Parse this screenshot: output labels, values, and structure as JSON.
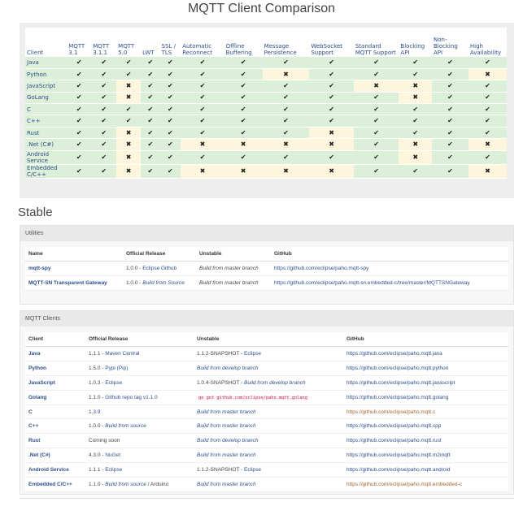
{
  "title": "MQTT Client Comparison",
  "comparison": {
    "headers": [
      "Client",
      "MQTT 3.1",
      "MQTT 3.1.1",
      "MQTT 5.0",
      "LWT",
      "SSL / TLS",
      "Automatic Reconnect",
      "Offline Buffering",
      "Message Persistence",
      "WebSocket Support",
      "Standard MQTT Support",
      "Blocking API",
      "Non-Blocking API",
      "High Availability"
    ],
    "yes_glyph": "✔",
    "no_glyph": "✖",
    "rows": [
      {
        "client": "Java",
        "values": [
          1,
          1,
          1,
          1,
          1,
          1,
          1,
          1,
          1,
          1,
          1,
          1,
          1
        ]
      },
      {
        "client": "Python",
        "values": [
          1,
          1,
          1,
          1,
          1,
          1,
          1,
          0,
          1,
          1,
          1,
          1,
          0
        ]
      },
      {
        "client": "JavaScript",
        "values": [
          1,
          1,
          0,
          1,
          1,
          1,
          1,
          1,
          1,
          0,
          0,
          1,
          1
        ]
      },
      {
        "client": "GoLang",
        "values": [
          1,
          1,
          0,
          1,
          1,
          1,
          1,
          1,
          1,
          1,
          0,
          1,
          1
        ]
      },
      {
        "client": "C",
        "values": [
          1,
          1,
          1,
          1,
          1,
          1,
          1,
          1,
          1,
          1,
          1,
          1,
          1
        ]
      },
      {
        "client": "C++",
        "values": [
          1,
          1,
          1,
          1,
          1,
          1,
          1,
          1,
          1,
          1,
          1,
          1,
          1
        ]
      },
      {
        "client": "Rust",
        "values": [
          1,
          1,
          0,
          1,
          1,
          1,
          1,
          1,
          0,
          1,
          1,
          1,
          1
        ]
      },
      {
        "client": ".Net (C#)",
        "values": [
          1,
          1,
          0,
          1,
          1,
          0,
          0,
          0,
          0,
          1,
          0,
          1,
          0
        ]
      },
      {
        "client": "Android Service",
        "values": [
          1,
          1,
          0,
          1,
          1,
          1,
          1,
          1,
          1,
          1,
          0,
          1,
          1
        ]
      },
      {
        "client": "Embedded C/C++",
        "values": [
          1,
          1,
          0,
          1,
          1,
          0,
          0,
          0,
          0,
          1,
          1,
          1,
          0
        ]
      }
    ]
  },
  "stable_heading": "Stable",
  "utilities": {
    "heading": "Utilities",
    "columns": [
      "Name",
      "Official Release",
      "Unstable",
      "GitHub"
    ],
    "rows": [
      {
        "name": "mqtt-spy",
        "release_version": "1.0.0 - ",
        "release_source": "Eclipse Github",
        "unstable": "Build from master branch",
        "github": "https://github.com/eclipse/paho.mqtt-spy"
      },
      {
        "name": "MQTT-SN Transparent Gateway",
        "release_version": "1.0.0 - ",
        "release_source": "Build from Source",
        "unstable": "Build from master branch",
        "github": "https://github.com/eclipse/paho.mqtt-sn.embedded-c/tree/master/MQTTSNGateway"
      }
    ]
  },
  "clients": {
    "heading": "MQTT Clients",
    "columns": [
      "Client",
      "Official Release",
      "Unstable",
      "GitHub"
    ],
    "rows": [
      {
        "name": "Java",
        "release_a": "1.1.1 - ",
        "release_b": "Maven Central",
        "release_c": "",
        "unstable_a": "1.1.2-SNAPSHOT - ",
        "unstable_b": "Eclipse",
        "github": "https://github.com/eclipse/paho.mqtt.java"
      },
      {
        "name": "Python",
        "release_a": "1.5.0 - ",
        "release_b": "Pypi (Pip)",
        "release_c": "",
        "unstable_a": "",
        "unstable_b": "Build from develop branch",
        "github": "https://github.com/eclipse/paho.mqtt.python"
      },
      {
        "name": "JavaScript",
        "release_a": "1.0.3 - ",
        "release_b": "Eclipse",
        "release_c": "",
        "unstable_a": "1.0.4-SNAPSHOT - ",
        "unstable_b": "Build from develop branch",
        "github": "https://github.com/eclipse/paho.mqtt.javascript"
      },
      {
        "name": "Golang",
        "release_a": "1.1.0 - ",
        "release_b": "Github repo tag v1.1.0",
        "release_c": "",
        "unstable_code": "go get github.com/eclipse/paho.mqtt.golang",
        "github": "https://github.com/eclipse/paho.mqtt.golang"
      },
      {
        "name": "C",
        "release_a": "",
        "release_b": "1.3.9",
        "release_c": "",
        "unstable_a": "",
        "unstable_b": "Build from master branch",
        "github": "https://github.com/eclipse/paho.mqtt.c"
      },
      {
        "name": "C++",
        "release_a": "1.0.0 - ",
        "release_b": "Build from source",
        "release_c": "",
        "unstable_a": "",
        "unstable_b": "Build from master branch",
        "github": "https://github.com/eclipse/paho.mqtt.cpp"
      },
      {
        "name": "Rust",
        "release_a": "Coming soon",
        "release_b": "",
        "release_c": "",
        "unstable_a": "",
        "unstable_b": "Build from develop branch",
        "github": "https://github.com/eclipse/paho.mqtt.rust"
      },
      {
        "name": ".Net (C#)",
        "release_a": "4.3.0 - ",
        "release_b": "NuGet",
        "release_c": "",
        "unstable_a": "",
        "unstable_b": "Build from master branch",
        "github": "https://github.com/eclipse/paho.mqtt.m2mqtt"
      },
      {
        "name": "Android Service",
        "release_a": "1.1.1 - ",
        "release_b": "Eclipse",
        "release_c": "",
        "unstable_a": "1.1.2-SNAPSHOT - ",
        "unstable_b": "Eclipse",
        "github": "https://github.com/eclipse/paho.mqtt.android"
      },
      {
        "name": "Embedded C/C++",
        "release_a": "1.1.0 - ",
        "release_b": "Build from source",
        "release_c": " / Arduino",
        "unstable_a": "",
        "unstable_b": "Build from master branch",
        "github": "https://github.com/eclipse/paho.mqtt.embedded-c"
      }
    ]
  }
}
